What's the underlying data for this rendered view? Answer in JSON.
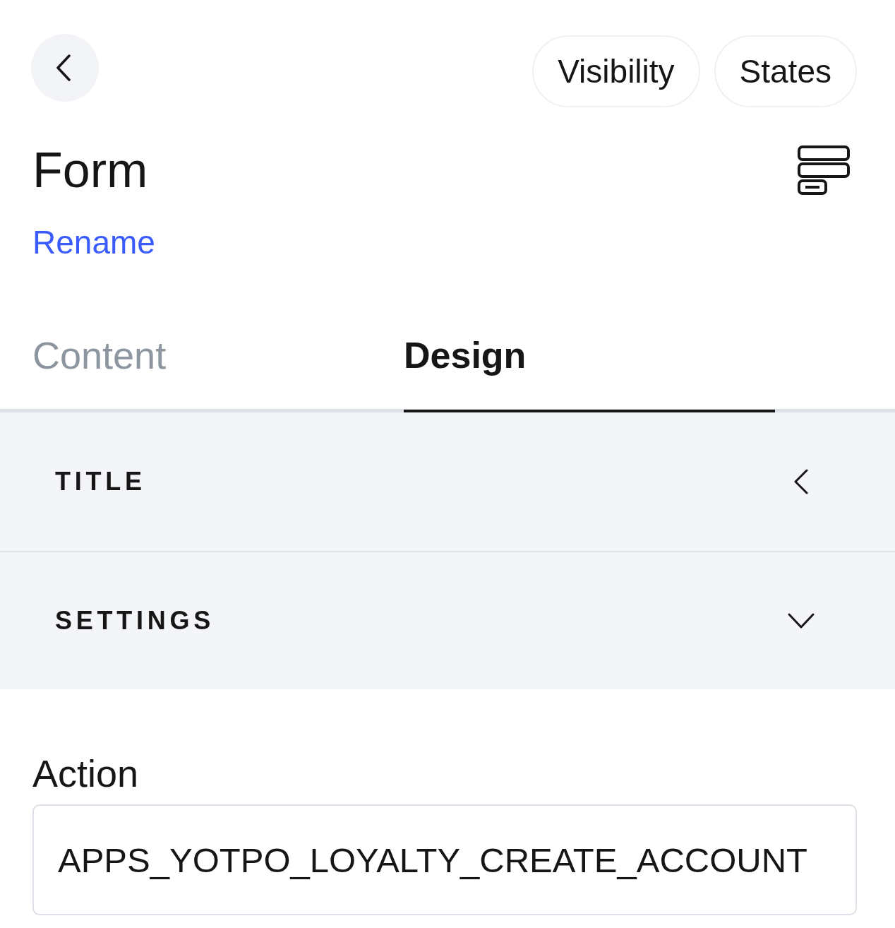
{
  "header_buttons": [
    {
      "label": "Visibility"
    },
    {
      "label": "States"
    }
  ],
  "component": {
    "title": "Form",
    "rename_link": "Rename"
  },
  "tabs": [
    {
      "label": "Content",
      "selected": false
    },
    {
      "label": "Design",
      "selected": true
    }
  ],
  "sections": [
    {
      "label": "TITLE",
      "expanded": false
    },
    {
      "label": "SETTINGS",
      "expanded": true,
      "fields": [
        {
          "label": "Action",
          "value": "APPS_YOTPO_LOYALTY_CREATE_ACCOUNT"
        }
      ]
    }
  ]
}
